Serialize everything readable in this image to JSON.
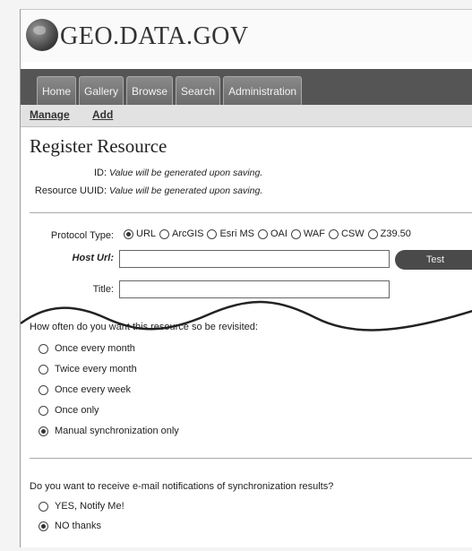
{
  "logo": {
    "text": "GEO.DATA.GOV"
  },
  "nav": {
    "tabs": [
      "Home",
      "Gallery",
      "Browse",
      "Search",
      "Administration"
    ],
    "sub": [
      "Manage",
      "Add"
    ]
  },
  "form": {
    "title": "Register Resource",
    "id_label": "ID:",
    "id_value": "Value will be generated upon saving.",
    "uuid_label": "Resource UUID:",
    "uuid_value": "Value will be generated upon saving.",
    "protocol_label": "Protocol Type:",
    "protocols": [
      "URL",
      "ArcGIS",
      "Esri MS",
      "OAI",
      "WAF",
      "CSW",
      "Z39.50"
    ],
    "protocol_selected": "URL",
    "host_label": "Host Url:",
    "host_value": "",
    "test_label": "Test",
    "title_label": "Title:",
    "title_value": ""
  },
  "revisit": {
    "question": "How often do you want this resource so be revisited:",
    "options": [
      "Once every month",
      "Twice every month",
      "Once every week",
      "Once only",
      "Manual synchronization only"
    ],
    "selected": "Manual synchronization only"
  },
  "notify": {
    "question": "Do you want to receive e-mail notifications of synchronization results?",
    "options": [
      "YES, Notify Me!",
      "NO thanks"
    ],
    "selected": "NO thanks"
  }
}
